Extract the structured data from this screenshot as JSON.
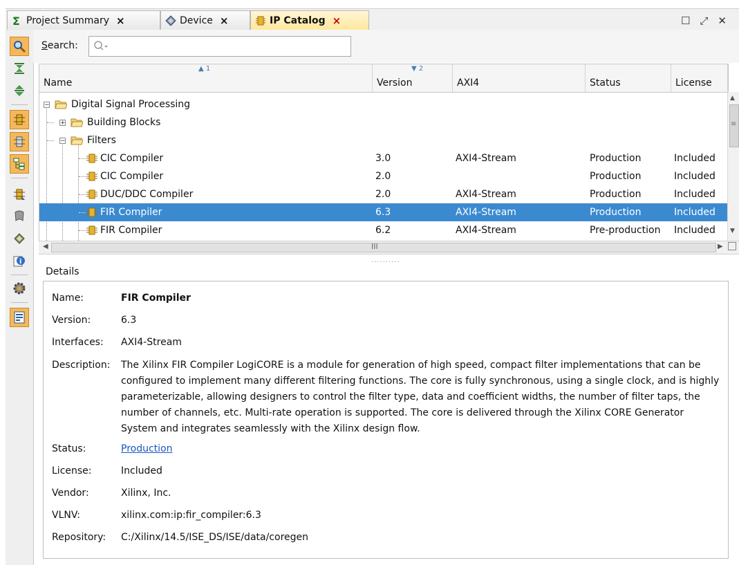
{
  "tabs": [
    {
      "label": "Project Summary",
      "icon": "sigma-icon"
    },
    {
      "label": "Device",
      "icon": "device-chip-icon"
    },
    {
      "label": "IP Catalog",
      "icon": "ip-core-icon"
    }
  ],
  "tab_close": "×",
  "window_controls": {
    "maximize": "☐",
    "float": "⤢",
    "close": "✕"
  },
  "search": {
    "label": "Search:",
    "mnemonic": "S",
    "rest": "earch:",
    "value": "",
    "placeholder": ""
  },
  "table": {
    "columns": [
      {
        "label": "Name",
        "sort": "▲ 1"
      },
      {
        "label": "Version",
        "sort": "▼ 2"
      },
      {
        "label": "AXI4",
        "sort": ""
      },
      {
        "label": "Status",
        "sort": ""
      },
      {
        "label": "License",
        "sort": ""
      }
    ],
    "rows": [
      {
        "name": "Digital Signal Processing",
        "version": "",
        "axi4": "",
        "status": "",
        "license": ""
      },
      {
        "name": "Building Blocks",
        "version": "",
        "axi4": "",
        "status": "",
        "license": ""
      },
      {
        "name": "Filters",
        "version": "",
        "axi4": "",
        "status": "",
        "license": ""
      },
      {
        "name": "CIC Compiler",
        "version": "3.0",
        "axi4": "AXI4-Stream",
        "status": "Production",
        "license": "Included"
      },
      {
        "name": "CIC Compiler",
        "version": "2.0",
        "axi4": "",
        "status": "Production",
        "license": "Included"
      },
      {
        "name": "DUC/DDC Compiler",
        "version": "2.0",
        "axi4": "AXI4-Stream",
        "status": "Production",
        "license": "Included"
      },
      {
        "name": "FIR Compiler",
        "version": "6.3",
        "axi4": "AXI4-Stream",
        "status": "Production",
        "license": "Included"
      },
      {
        "name": "FIR Compiler",
        "version": "6.2",
        "axi4": "AXI4-Stream",
        "status": "Pre-production",
        "license": "Included"
      }
    ],
    "selected_row": 6,
    "hscroll_label": "III"
  },
  "details": {
    "title": "Details",
    "name_label": "Name:",
    "name": "FIR Compiler",
    "version_label": "Version:",
    "version": "6.3",
    "interfaces_label": "Interfaces:",
    "interfaces": "AXI4-Stream",
    "description_label": "Description:",
    "description": "The Xilinx FIR Compiler LogiCORE is a module for generation of high speed, compact filter implementations that can be configured to implement many different filtering functions. The core is fully synchronous, using a single clock, and is highly parameterizable, allowing designers to control the filter type, data and coefficient widths, the number of filter taps, the number of channels, etc. Multi-rate operation is supported. The core is delivered through the Xilinx CORE Generator System and integrates seamlessly with the Xilinx design flow.",
    "status_label": "Status:",
    "status": "Production",
    "license_label": "License:",
    "license": "Included",
    "vendor_label": "Vendor:",
    "vendor": "Xilinx, Inc.",
    "vlnv_label": "VLNV:",
    "vlnv": "xilinx.com:ip:fir_compiler:6.3",
    "repository_label": "Repository:",
    "repository": "C:/Xilinx/14.5/ISE_DS/ISE/data/coregen"
  },
  "colors": {
    "selection": "#3b8ad0",
    "active_tab": "#ffe79a",
    "link": "#1a56c0",
    "toolbar_toggle": "#f4b85a"
  }
}
